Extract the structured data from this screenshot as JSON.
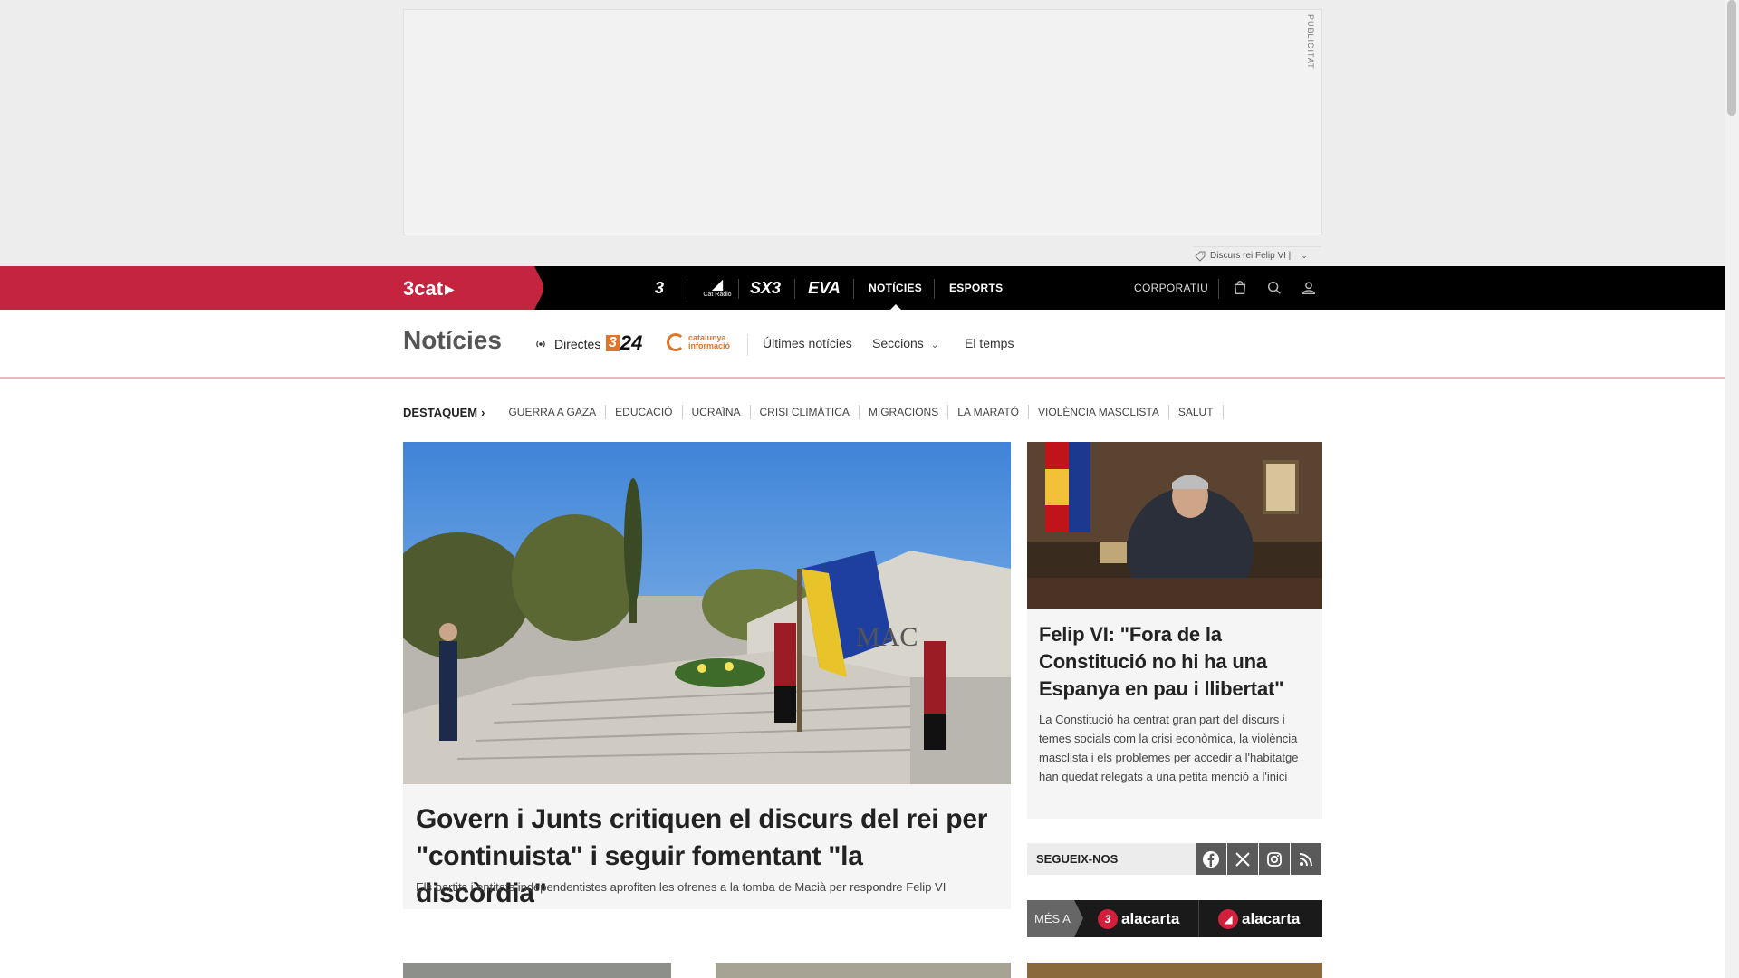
{
  "ad": {
    "label": "PUBLICITAT"
  },
  "topic_tag": {
    "label": "Discurs rei Felip VI |"
  },
  "nav": {
    "brand": "3cat",
    "channels": [
      "3",
      "Cat Ràdio",
      "SX3",
      "EVA"
    ],
    "links": [
      "NOTÍCIES",
      "ESPORTS"
    ],
    "corporate": "CORPORATIU",
    "icons": [
      "shopping-bag-icon",
      "search-icon",
      "user-icon"
    ]
  },
  "section": {
    "title": "Notícies",
    "live": "Directes",
    "live_channels": [
      "3/24",
      "catalunya informació"
    ],
    "links": [
      "Últimes notícies",
      "Seccions",
      "El temps"
    ]
  },
  "highlights": {
    "label": "DESTAQUEM",
    "items": [
      "GUERRA A GAZA",
      "EDUCACIÓ",
      "UCRAÏNA",
      "CRISI CLIMÀTICA",
      "MIGRACIONS",
      "LA MARATÓ",
      "VIOLÈNCIA MASCLISTA",
      "SALUT"
    ]
  },
  "main_article": {
    "title": "Govern i Junts critiquen el discurs del rei per \"continuista\" i seguir fomentant \"la discòrdia\"",
    "subtitle": "Els partits i entitats independentistes aprofiten les ofrenes a la tomba de Macià per respondre Felip VI"
  },
  "side_article": {
    "title": "Felip VI: \"Fora de la Constitució no hi ha una Espanya en pau i llibertat\"",
    "subtitle": "La Constitució ha centrat gran part del discurs i temes socials com la crisi econòmica, la violència masclista i els problemes per accedir a l'habitatge han quedat relegats a una petita menció a l'inici"
  },
  "follow": {
    "label": "SEGUEIX-NOS",
    "networks": [
      "facebook-icon",
      "x-icon",
      "instagram-icon",
      "rss-icon"
    ]
  },
  "mes_a": {
    "label": "MÉS A",
    "services": [
      "alacarta",
      "alacarta"
    ]
  },
  "colors": {
    "brand": "#c4243e",
    "nav_bg": "#000000",
    "accent_324": "#e0752a"
  }
}
